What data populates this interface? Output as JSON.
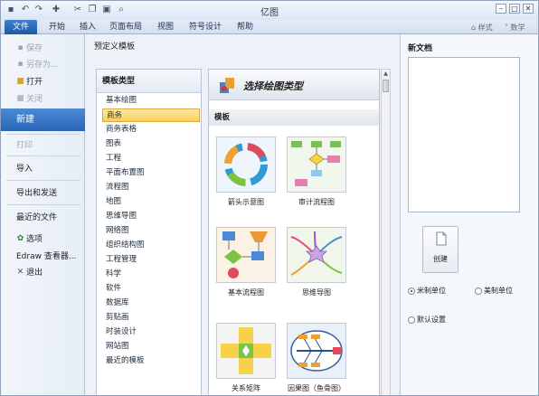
{
  "window": {
    "title": "亿图"
  },
  "quick_access": [
    "save-icon",
    "undo-icon",
    "redo-icon",
    "new-icon",
    "cut-icon",
    "copy-icon",
    "paste-icon",
    "print-preview-icon"
  ],
  "ribbon": {
    "tabs": [
      "文件",
      "开始",
      "插入",
      "页面布局",
      "视图",
      "符号设计",
      "帮助"
    ],
    "style_label": "样式",
    "theme_label": "数学"
  },
  "left_nav": {
    "save": "保存",
    "save_as": "另存为...",
    "open": "打开",
    "close": "关闭",
    "new": "新建",
    "print": "打印",
    "import": "导入",
    "export_send": "导出和发送",
    "recent_files": "最近的文件",
    "options": "选项",
    "viewer": "Edraw 查看器...",
    "exit": "退出"
  },
  "center": {
    "predefined_title": "预定义模板",
    "categories_header": "模板类型",
    "categories": [
      "基本绘图",
      "商务",
      "商务表格",
      "图表",
      "工程",
      "平面布置图",
      "流程图",
      "地图",
      "思维导图",
      "网络图",
      "组织结构图",
      "工程管理",
      "科学",
      "软件",
      "数据库",
      "剪贴画",
      "时装设计",
      "网站图",
      "最近的模板"
    ],
    "selected_category": "商务",
    "banner_title": "选择绘图类型",
    "templates_label": "模板",
    "templates": [
      {
        "name": "箭头示意图",
        "icon": "arrow-cycle-icon"
      },
      {
        "name": "审计流程图",
        "icon": "audit-flowchart-icon"
      },
      {
        "name": "基本流程图",
        "icon": "basic-flowchart-icon"
      },
      {
        "name": "思维导图",
        "icon": "mind-map-icon"
      },
      {
        "name": "关系矩阵",
        "icon": "relation-matrix-icon"
      },
      {
        "name": "因果图（鱼骨图）",
        "icon": "fishbone-icon"
      }
    ]
  },
  "right": {
    "new_doc_label": "新文档",
    "create_label": "创建",
    "units": [
      "米制单位",
      "美制单位"
    ],
    "selected_unit": "米制单位",
    "default_settings": "默认设置"
  },
  "colors": {
    "accent": "#2a66b5",
    "selection": "#f8d05c"
  }
}
